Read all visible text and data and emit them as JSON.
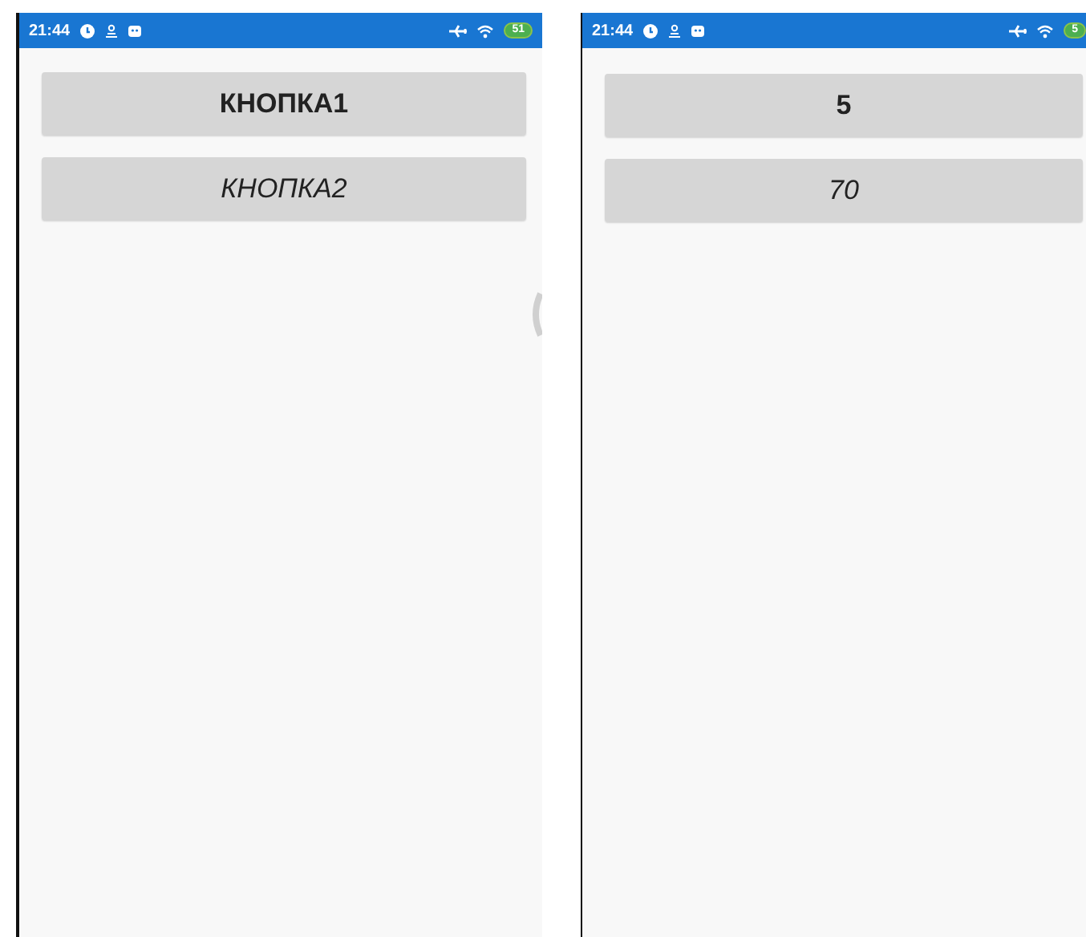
{
  "screens": [
    {
      "status_bar": {
        "time": "21:44",
        "battery": "51"
      },
      "edge_indicator": true,
      "buttons": [
        {
          "label": "КНОПКА1",
          "kind": "bold"
        },
        {
          "label": "КНОПКА2",
          "kind": "italic"
        }
      ]
    },
    {
      "status_bar": {
        "time": "21:44",
        "battery": "5"
      },
      "edge_indicator": false,
      "buttons": [
        {
          "label": "5",
          "kind": "bold"
        },
        {
          "label": "70",
          "kind": "italic"
        }
      ]
    }
  ]
}
